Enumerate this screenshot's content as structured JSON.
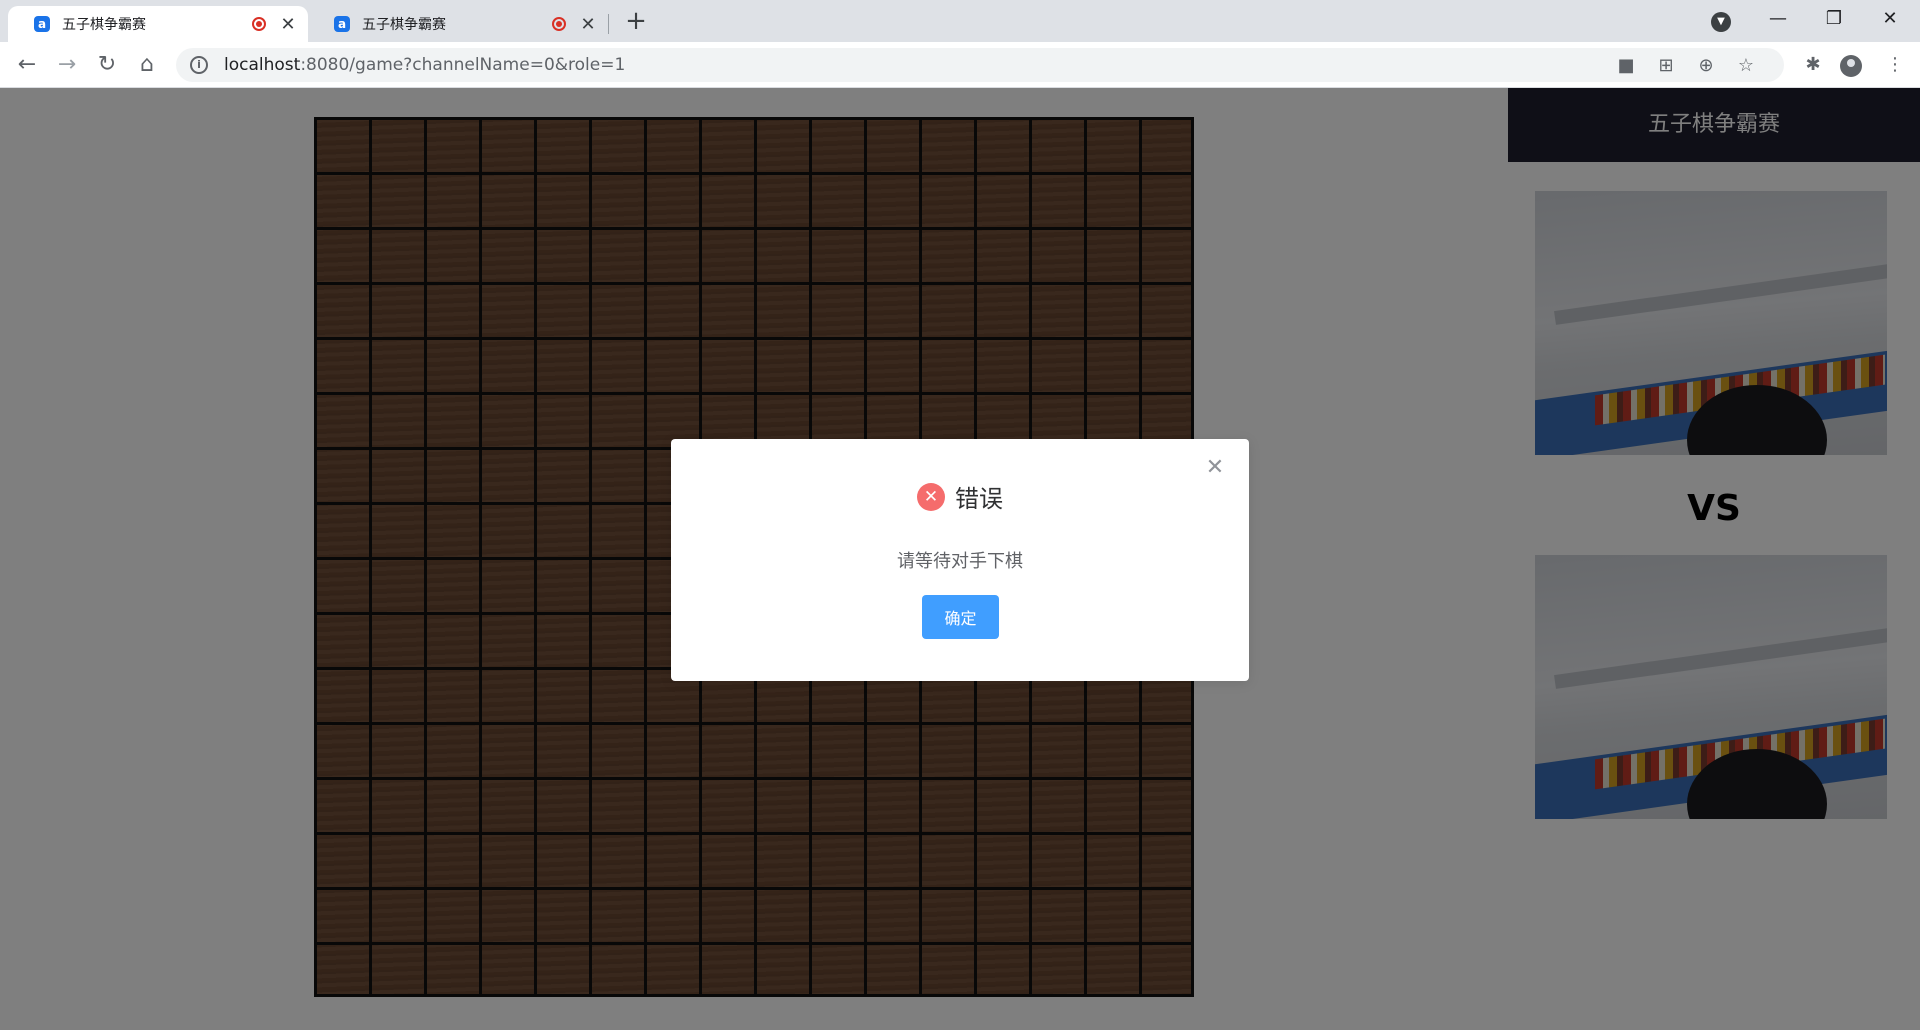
{
  "browser": {
    "tabs": [
      {
        "title": "五子棋争霸赛",
        "active": true
      },
      {
        "title": "五子棋争霸赛",
        "active": false
      }
    ],
    "address": {
      "host": "localhost",
      "rest": ":8080/game?channelName=0&role=1"
    }
  },
  "sidebar": {
    "title": "五子棋争霸赛",
    "vs_label": "VS"
  },
  "dialog": {
    "title": "错误",
    "message": "请等待对手下棋",
    "confirm_label": "确定"
  },
  "colors": {
    "accent": "#409eff",
    "error": "#f56c6c",
    "board": "#6e4a34",
    "header_dark": "#1f1f2e"
  }
}
